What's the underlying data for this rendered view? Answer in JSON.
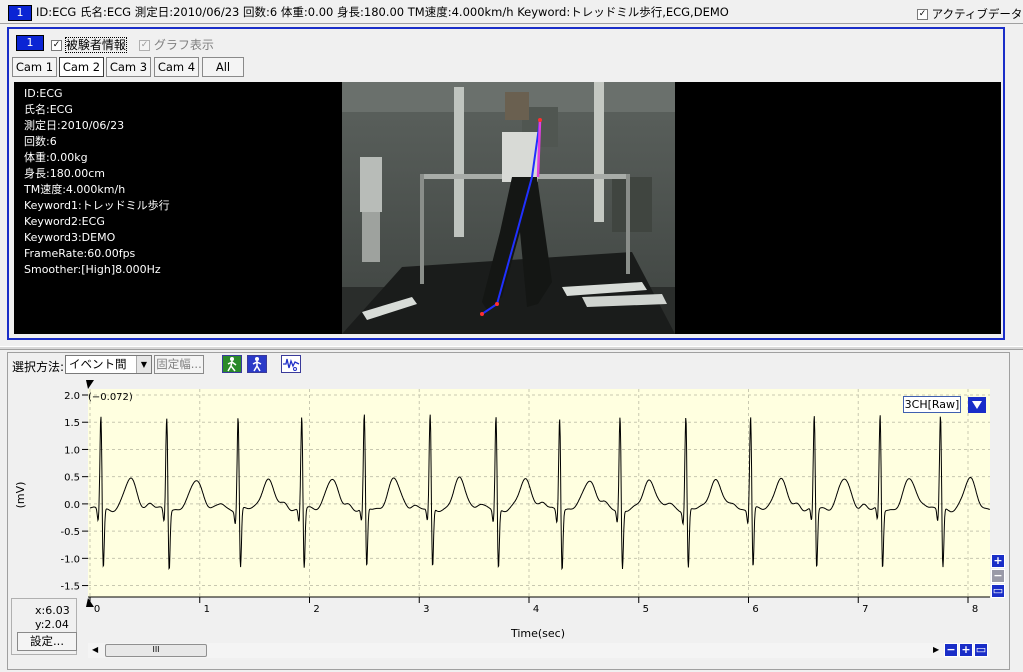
{
  "top_bar": {
    "number": "1",
    "info": "ID:ECG 氏名:ECG 測定日:2010/06/23 回数:6 体重:0.00 身長:180.00 TM速度:4.000km/h Keyword:トレッドミル歩行,ECG,DEMO",
    "active_label": "アクティブデータ",
    "active_checked": true
  },
  "panel": {
    "number": "1",
    "subject_info_label": "被験者情報",
    "graph_label": "グラフ表示",
    "cams": [
      "Cam 1",
      "Cam 2",
      "Cam 3",
      "Cam 4",
      "All"
    ],
    "active_cam": "Cam 2"
  },
  "overlay": [
    "ID:ECG",
    "氏名:ECG",
    "測定日:2010/06/23",
    "回数:6",
    "体重:0.00kg",
    "身長:180.00cm",
    "TM速度:4.000km/h",
    "Keyword1:トレッドミル歩行",
    "Keyword2:ECG",
    "Keyword3:DEMO",
    "FrameRate:60.00fps",
    "Smoother:[High]8.000Hz"
  ],
  "toolbar": {
    "select_label": "選択方法:",
    "select_value": "イベント間",
    "fixed_label": "固定幅..."
  },
  "chart_data": {
    "type": "line",
    "title": "",
    "xlabel": "Time(sec)",
    "ylabel": "(mV)",
    "xlim": [
      0,
      8.2
    ],
    "ylim": [
      -1.6,
      2.0
    ],
    "x_ticks": [
      "0",
      "1",
      "2",
      "3",
      "4",
      "5",
      "6",
      "7",
      "8"
    ],
    "y_ticks": [
      "2.0",
      "1.5",
      "1.0",
      "0.5",
      "0.0",
      "-0.5",
      "-1.0",
      "-1.5"
    ],
    "cursor_label": "(−0.072)",
    "channel_label": "3CH[Raw]",
    "grid": true,
    "beat_times": [
      0.1,
      0.7,
      1.35,
      1.93,
      2.5,
      3.1,
      3.7,
      4.28,
      4.83,
      5.43,
      6.02,
      6.6,
      7.2,
      7.75
    ]
  },
  "readout": {
    "x": "x:6.03",
    "y": "y:2.04",
    "settings_label": "設定..."
  },
  "scroll": {
    "thumb_label": "III"
  },
  "colors": {
    "accent": "#1a2ec8",
    "plot_bg": "#ffffe0",
    "trace": "#000000"
  }
}
